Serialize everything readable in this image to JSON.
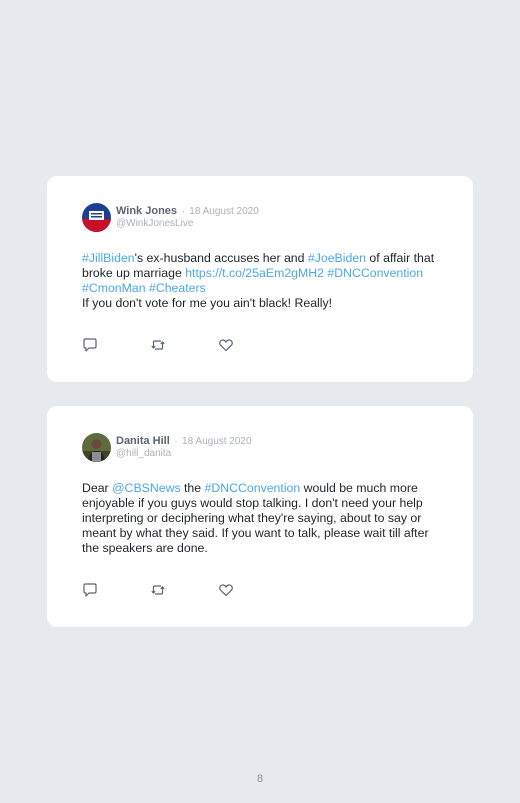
{
  "page_number": "8",
  "tweets": [
    {
      "author": "Wink Jones",
      "separator": "·",
      "date": "18 August 2020",
      "handle": "@WinkJonesLive",
      "avatar_icon": "flag-avatar",
      "segments": [
        {
          "text": "#JillBiden",
          "link": true
        },
        {
          "text": "'s ex-husband accuses her and ",
          "link": false
        },
        {
          "text": "#JoeBiden",
          "link": true
        },
        {
          "text": " of affair that broke up marriage ",
          "link": false
        },
        {
          "text": "https://t.co/25aEm2gMH2",
          "link": true
        },
        {
          "text": " ",
          "link": false
        },
        {
          "text": "#DNCConvention",
          "link": true
        },
        {
          "text": " ",
          "link": false
        },
        {
          "text": "#CmonMan",
          "link": true
        },
        {
          "text": " ",
          "link": false
        },
        {
          "text": "#Cheaters",
          "link": true
        },
        {
          "text": "\nIf you don't vote for me you ain't black! Really!",
          "link": false
        }
      ]
    },
    {
      "author": "Danita Hill",
      "separator": "·",
      "date": "18 August 2020",
      "handle": "@hill_danita",
      "avatar_icon": "profile-photo-avatar",
      "segments": [
        {
          "text": "Dear ",
          "link": false
        },
        {
          "text": "@CBSNews",
          "link": true
        },
        {
          "text": " the ",
          "link": false
        },
        {
          "text": "#DNCConvention",
          "link": true
        },
        {
          "text": " would be much more enjoyable if you guys would stop talking. I don't need your help interpreting or deciphering what they're saying, about to say or meant by what they said. If you want to talk, please wait till after the speakers are done.",
          "link": false
        }
      ]
    }
  ],
  "icons": {
    "reply": "reply-icon",
    "retweet": "retweet-icon",
    "like": "heart-icon"
  },
  "colors": {
    "background": "#e6e9ee",
    "card": "#ffffff",
    "link": "#4aa8e8",
    "muted": "#aab1ba",
    "author": "#5b6470"
  }
}
